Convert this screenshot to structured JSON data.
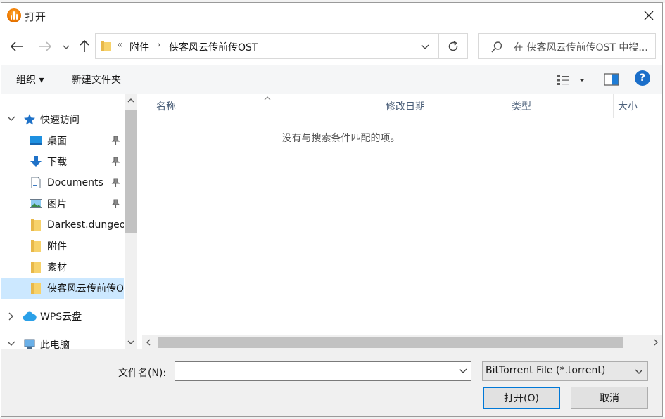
{
  "window": {
    "title": "打开",
    "app_icon": "app-logo-icon",
    "close_icon": "close-icon"
  },
  "address": {
    "back_icon": "arrow-left-icon",
    "forward_icon": "arrow-right-icon",
    "recent_icon": "chevron-down-icon",
    "up_icon": "arrow-up-icon",
    "overflow": "«",
    "path": [
      "附件",
      "侠客风云传前传OST"
    ],
    "separator": "›",
    "refresh_icon": "refresh-icon"
  },
  "search": {
    "placeholder": "在 侠客风云传前传OST 中搜...",
    "icon": "search-icon"
  },
  "toolbar": {
    "organize": "组织 ▾",
    "new_folder": "新建文件夹",
    "view_icon": "view-options-icon",
    "preview_icon": "preview-pane-icon",
    "help": "?"
  },
  "nav": {
    "items": [
      {
        "label": "快速访问",
        "icon": "star-icon",
        "chevron": "expanded"
      },
      {
        "label": "桌面",
        "icon": "desktop-icon",
        "pinned": true
      },
      {
        "label": "下载",
        "icon": "download-icon",
        "pinned": true
      },
      {
        "label": "Documents",
        "icon": "document-icon",
        "pinned": true
      },
      {
        "label": "图片",
        "icon": "picture-icon",
        "pinned": true
      },
      {
        "label": "Darkest.dungeon",
        "icon": "folder-icon"
      },
      {
        "label": "附件",
        "icon": "folder-icon"
      },
      {
        "label": "素材",
        "icon": "folder-icon"
      },
      {
        "label": "侠客风云传前传OST",
        "icon": "folder-icon",
        "selected": true
      },
      {
        "label": "WPS云盘",
        "icon": "cloud-icon",
        "chevron": "collapsed"
      },
      {
        "label": "此电脑",
        "icon": "computer-icon",
        "chevron": "expanded"
      }
    ]
  },
  "filelist": {
    "columns": [
      "名称",
      "修改日期",
      "类型",
      "大小"
    ],
    "sorted_column": "名称",
    "empty_message": "没有与搜索条件匹配的项。"
  },
  "footer": {
    "filename_label": "文件名(N):",
    "filename_value": "",
    "filetype": "BitTorrent File (*.torrent)",
    "open": "打开(O)",
    "cancel": "取消"
  },
  "colors": {
    "accent": "#0078d7",
    "selection": "#cce8ff",
    "toolbar_bg": "#f5f6f7",
    "footer_bg": "#f0f0f0"
  }
}
